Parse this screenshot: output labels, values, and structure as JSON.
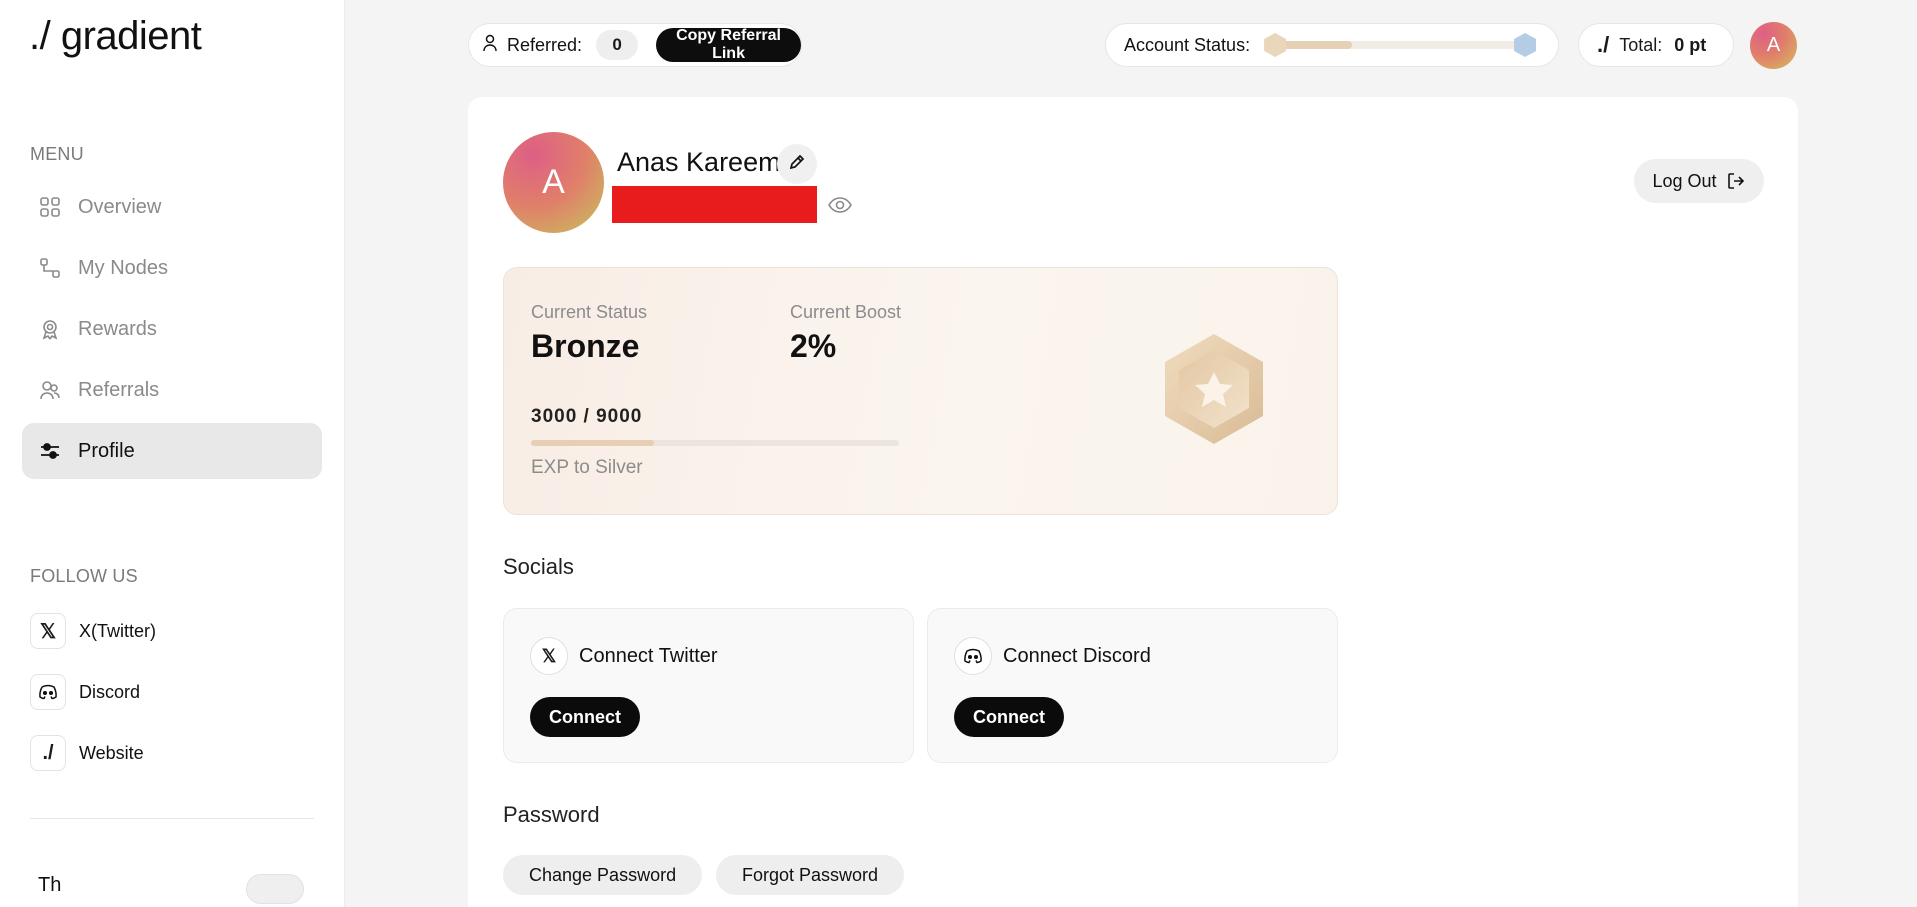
{
  "sidebar": {
    "logo": "./ gradient",
    "menu_title": "MENU",
    "items": [
      {
        "label": "Overview",
        "icon": "grid-icon"
      },
      {
        "label": "My Nodes",
        "icon": "nodes-icon"
      },
      {
        "label": "Rewards",
        "icon": "award-icon"
      },
      {
        "label": "Referrals",
        "icon": "users-icon"
      },
      {
        "label": "Profile",
        "icon": "sliders-icon",
        "active": true
      }
    ],
    "follow_title": "FOLLOW US",
    "follow": [
      {
        "label": "X(Twitter)",
        "icon": "x-twitter-icon"
      },
      {
        "label": "Discord",
        "icon": "discord-icon"
      },
      {
        "label": "Website",
        "icon": "gradient-logo-icon"
      }
    ],
    "theme_label": "Th"
  },
  "topbar": {
    "referred_label": "Referred:",
    "referred_count": "0",
    "copy_referral": "Copy Referral Link",
    "account_status_label": "Account Status:",
    "account_status_progress": 0.33,
    "total_label": "Total:",
    "total_value": "0 pt",
    "avatar_initial": "A"
  },
  "profile": {
    "avatar_initial": "A",
    "name": "Anas Kareem",
    "logout_label": "Log Out"
  },
  "status_card": {
    "current_status_label": "Current Status",
    "current_status": "Bronze",
    "current_boost_label": "Current Boost",
    "current_boost": "2%",
    "exp_current": 3000,
    "exp_target": 9000,
    "exp_text": "3000 / 9000",
    "exp_to": "EXP to Silver",
    "colors": {
      "bronze": "#e6d1b4",
      "silver": "#a9c4de"
    }
  },
  "socials": {
    "title": "Socials",
    "cards": [
      {
        "title": "Connect Twitter",
        "button": "Connect",
        "icon": "x-twitter-icon"
      },
      {
        "title": "Connect Discord",
        "button": "Connect",
        "icon": "discord-icon"
      }
    ]
  },
  "password": {
    "title": "Password",
    "change": "Change Password",
    "forgot": "Forgot Password"
  }
}
